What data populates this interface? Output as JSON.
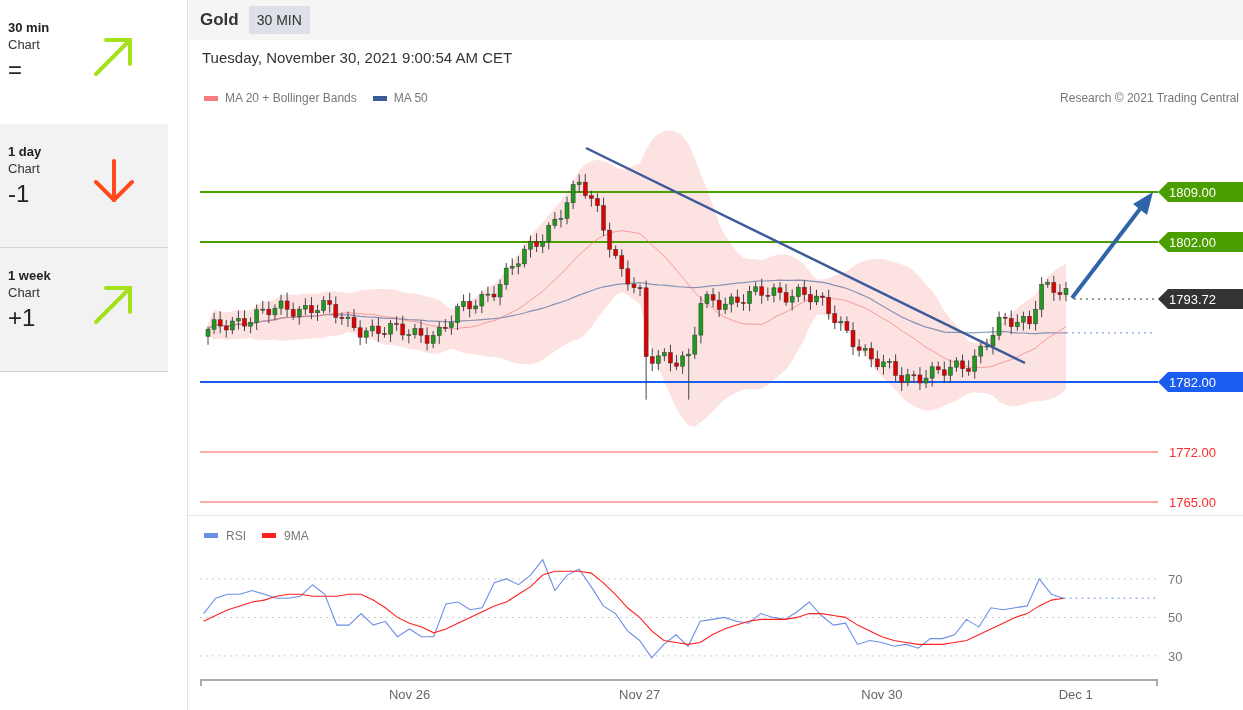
{
  "sidebar": {
    "items": [
      {
        "timeframe": "30 min",
        "label": "Chart",
        "score": "=",
        "kind": "up",
        "selected": true
      },
      {
        "timeframe": "1 day",
        "label": "Chart",
        "score": "-1",
        "kind": "down",
        "selected": false
      },
      {
        "timeframe": "1 week",
        "label": "Chart",
        "score": "+1",
        "kind": "up",
        "selected": false
      }
    ]
  },
  "header": {
    "title": "Gold",
    "interval": "30 MIN"
  },
  "timestamp": "Tuesday, November 30, 2021 9:00:54 AM CET",
  "legend": [
    {
      "label": "MA 20 + Bollinger Bands",
      "color": "#f47c7c"
    },
    {
      "label": "MA 50",
      "color": "#3b5b9a"
    }
  ],
  "credit": "Research © 2021 Trading Central",
  "levels": [
    {
      "label": "1809.00",
      "kind": "tag",
      "color": "#4a9e00"
    },
    {
      "label": "1802.00",
      "kind": "tag",
      "color": "#4a9e00"
    },
    {
      "label": "1793.72",
      "kind": "dotted",
      "color": "#333333"
    },
    {
      "label": "1782.00",
      "kind": "tag",
      "color": "#1a5cf0"
    },
    {
      "label": "1772.00",
      "kind": "plain",
      "color": "#ff2b2b"
    },
    {
      "label": "1765.00",
      "kind": "plain",
      "color": "#ff2b2b"
    }
  ],
  "rsi": {
    "chart_data": {
      "type": "line",
      "grid": true,
      "legend": "upper left",
      "ylim": [
        17.5,
        103.2
      ],
      "yticks": [
        30,
        50,
        70
      ],
      "categories": [
        null,
        null,
        null,
        null,
        null,
        null,
        null,
        null,
        null,
        null,
        null,
        null,
        null,
        null,
        null,
        null,
        null,
        "Nov 26",
        null,
        null,
        null,
        null,
        null,
        null,
        null,
        null,
        null,
        null,
        null,
        null,
        null,
        null,
        null,
        null,
        null,
        null,
        "Nov 27",
        null,
        null,
        null,
        null,
        null,
        null,
        null,
        null,
        null,
        null,
        null,
        null,
        null,
        null,
        null,
        null,
        null,
        null,
        null,
        "Nov 30",
        null,
        null,
        null,
        null,
        null,
        null,
        null,
        null,
        null,
        null,
        null,
        null,
        null,
        null,
        null,
        "Dec 1",
        null,
        null,
        null,
        null,
        null,
        null
      ],
      "series": [
        {
          "name": "RSI",
          "color": "#6b8ee6",
          "values": [
            52,
            60,
            62,
            62,
            64,
            62,
            60,
            60,
            61,
            67,
            62,
            46,
            46,
            52,
            46,
            48,
            40,
            44,
            40,
            40,
            57,
            58,
            54,
            55,
            68,
            70,
            67,
            72,
            80,
            64,
            72,
            75,
            66,
            56,
            52,
            43,
            38,
            29,
            36,
            41,
            35,
            48,
            49,
            50,
            48,
            47,
            52,
            50,
            49,
            53,
            58,
            51,
            46,
            47,
            36,
            38,
            37,
            35,
            36,
            34,
            39,
            39,
            41,
            49,
            45,
            55,
            54,
            55,
            56,
            70,
            62,
            60,
            null,
            null,
            null,
            null,
            null,
            null,
            null
          ]
        },
        {
          "name": "9MA",
          "color": "#ff2020",
          "values": [
            48,
            51,
            54,
            56,
            58,
            59,
            61,
            62,
            62,
            61,
            61,
            61,
            62,
            62,
            59,
            55,
            50,
            47,
            45,
            42,
            44,
            47,
            50,
            53,
            56,
            58,
            62,
            66,
            72,
            74,
            74,
            74,
            73,
            68,
            62,
            55,
            50,
            43,
            38,
            37,
            36,
            37,
            41,
            44,
            46,
            48,
            49,
            49,
            49,
            50,
            52,
            52,
            51,
            50,
            46,
            43,
            40,
            38,
            37,
            36,
            36,
            36,
            37,
            38,
            41,
            44,
            47,
            50,
            52,
            56,
            59,
            60,
            null,
            null,
            null,
            null,
            null,
            null,
            null
          ]
        }
      ]
    }
  }
}
